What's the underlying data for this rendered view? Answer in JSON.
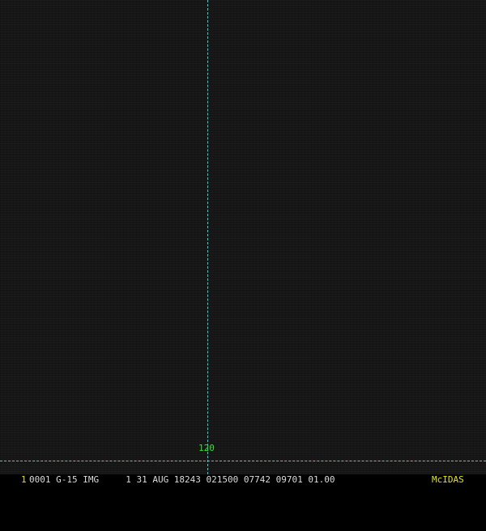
{
  "display": {
    "background_color": "#161616",
    "grid_color": "#2fd6d6",
    "label_color": "#33e033"
  },
  "grid": {
    "longitude_label": "120"
  },
  "status_bar": {
    "frame_number": "1",
    "caption": "0001 G-15 IMG     1 31 AUG 18243 021500 07742 09701 01.00",
    "brand": "McIDAS",
    "frame_number_color": "#e6e600",
    "caption_color": "#dcdcdc",
    "brand_color": "#e6e600"
  }
}
